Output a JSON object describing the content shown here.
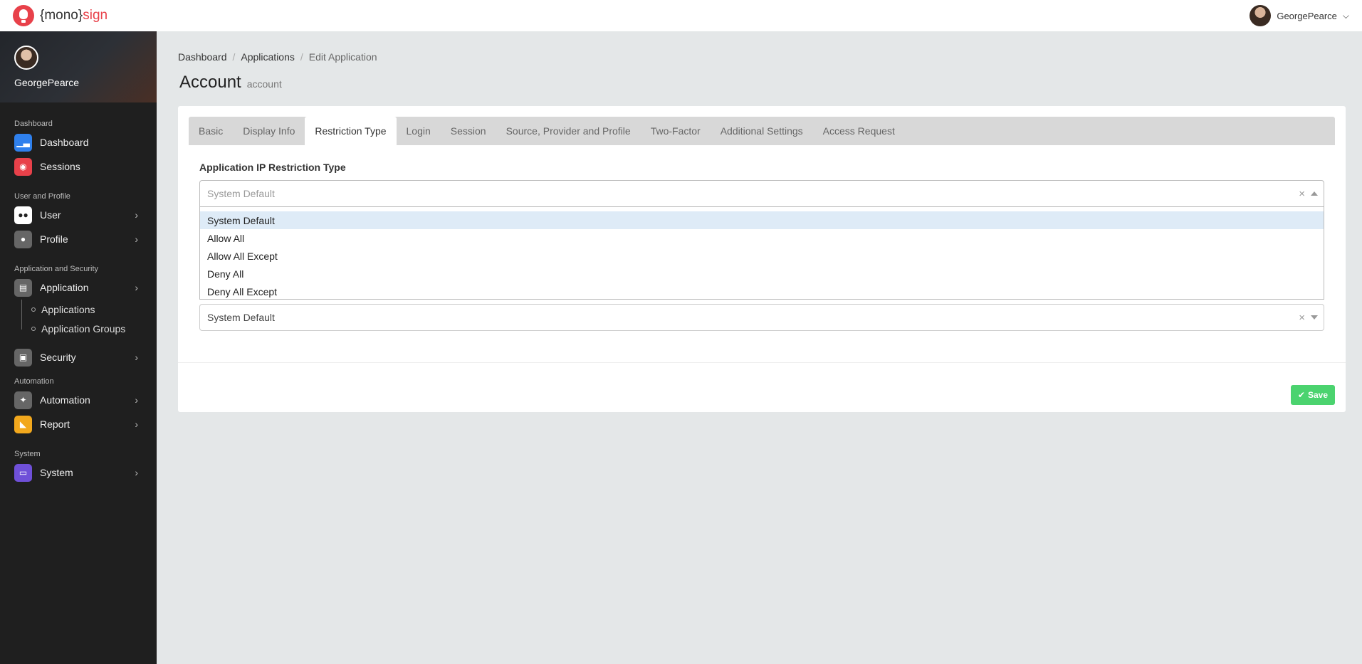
{
  "topbar": {
    "logo_prefix": "{mono}",
    "logo_suffix": "sign",
    "user_name": "GeorgePearce"
  },
  "sidebar": {
    "profile_name": "GeorgePearce",
    "sections": [
      {
        "title": "Dashboard"
      },
      {
        "title": "User and Profile"
      },
      {
        "title": "Application and Security"
      },
      {
        "title": "Automation"
      },
      {
        "title": "System"
      }
    ],
    "items": {
      "dashboard": {
        "label": "Dashboard",
        "icon": "chart-icon",
        "color": "#2f80ed"
      },
      "sessions": {
        "label": "Sessions",
        "icon": "record-icon",
        "color": "#e8414a"
      },
      "user": {
        "label": "User",
        "icon": "users-icon",
        "color": "#ffffff"
      },
      "profile": {
        "label": "Profile",
        "icon": "person-icon",
        "color": "#666666"
      },
      "application": {
        "label": "Application",
        "icon": "window-icon",
        "color": "#666666"
      },
      "applications": {
        "label": "Applications"
      },
      "application_groups": {
        "label": "Application Groups"
      },
      "security": {
        "label": "Security",
        "icon": "lock-icon",
        "color": "#666666"
      },
      "automation": {
        "label": "Automation",
        "icon": "magic-wand-icon",
        "color": "#666666"
      },
      "report": {
        "label": "Report",
        "icon": "area-chart-icon",
        "color": "#f2a81d"
      },
      "system": {
        "label": "System",
        "icon": "monitor-icon",
        "color": "#6f50d8"
      }
    }
  },
  "breadcrumb": {
    "items": [
      "Dashboard",
      "Applications",
      "Edit Application"
    ]
  },
  "page": {
    "title": "Account",
    "subtitle": "account"
  },
  "tabs": [
    "Basic",
    "Display Info",
    "Restriction Type",
    "Login",
    "Session",
    "Source, Provider and Profile",
    "Two-Factor",
    "Additional Settings",
    "Access Request"
  ],
  "active_tab": "Restriction Type",
  "form": {
    "label": "Application IP Restriction Type",
    "open_select_placeholder": "System Default",
    "options": [
      "System Default",
      "Allow All",
      "Allow All Except",
      "Deny All",
      "Deny All Except"
    ],
    "second_select_value": "System Default",
    "save_label": "Save"
  },
  "colors": {
    "brand": "#e8414a",
    "save": "#4bd36f",
    "selected_option": "#deebf7"
  }
}
